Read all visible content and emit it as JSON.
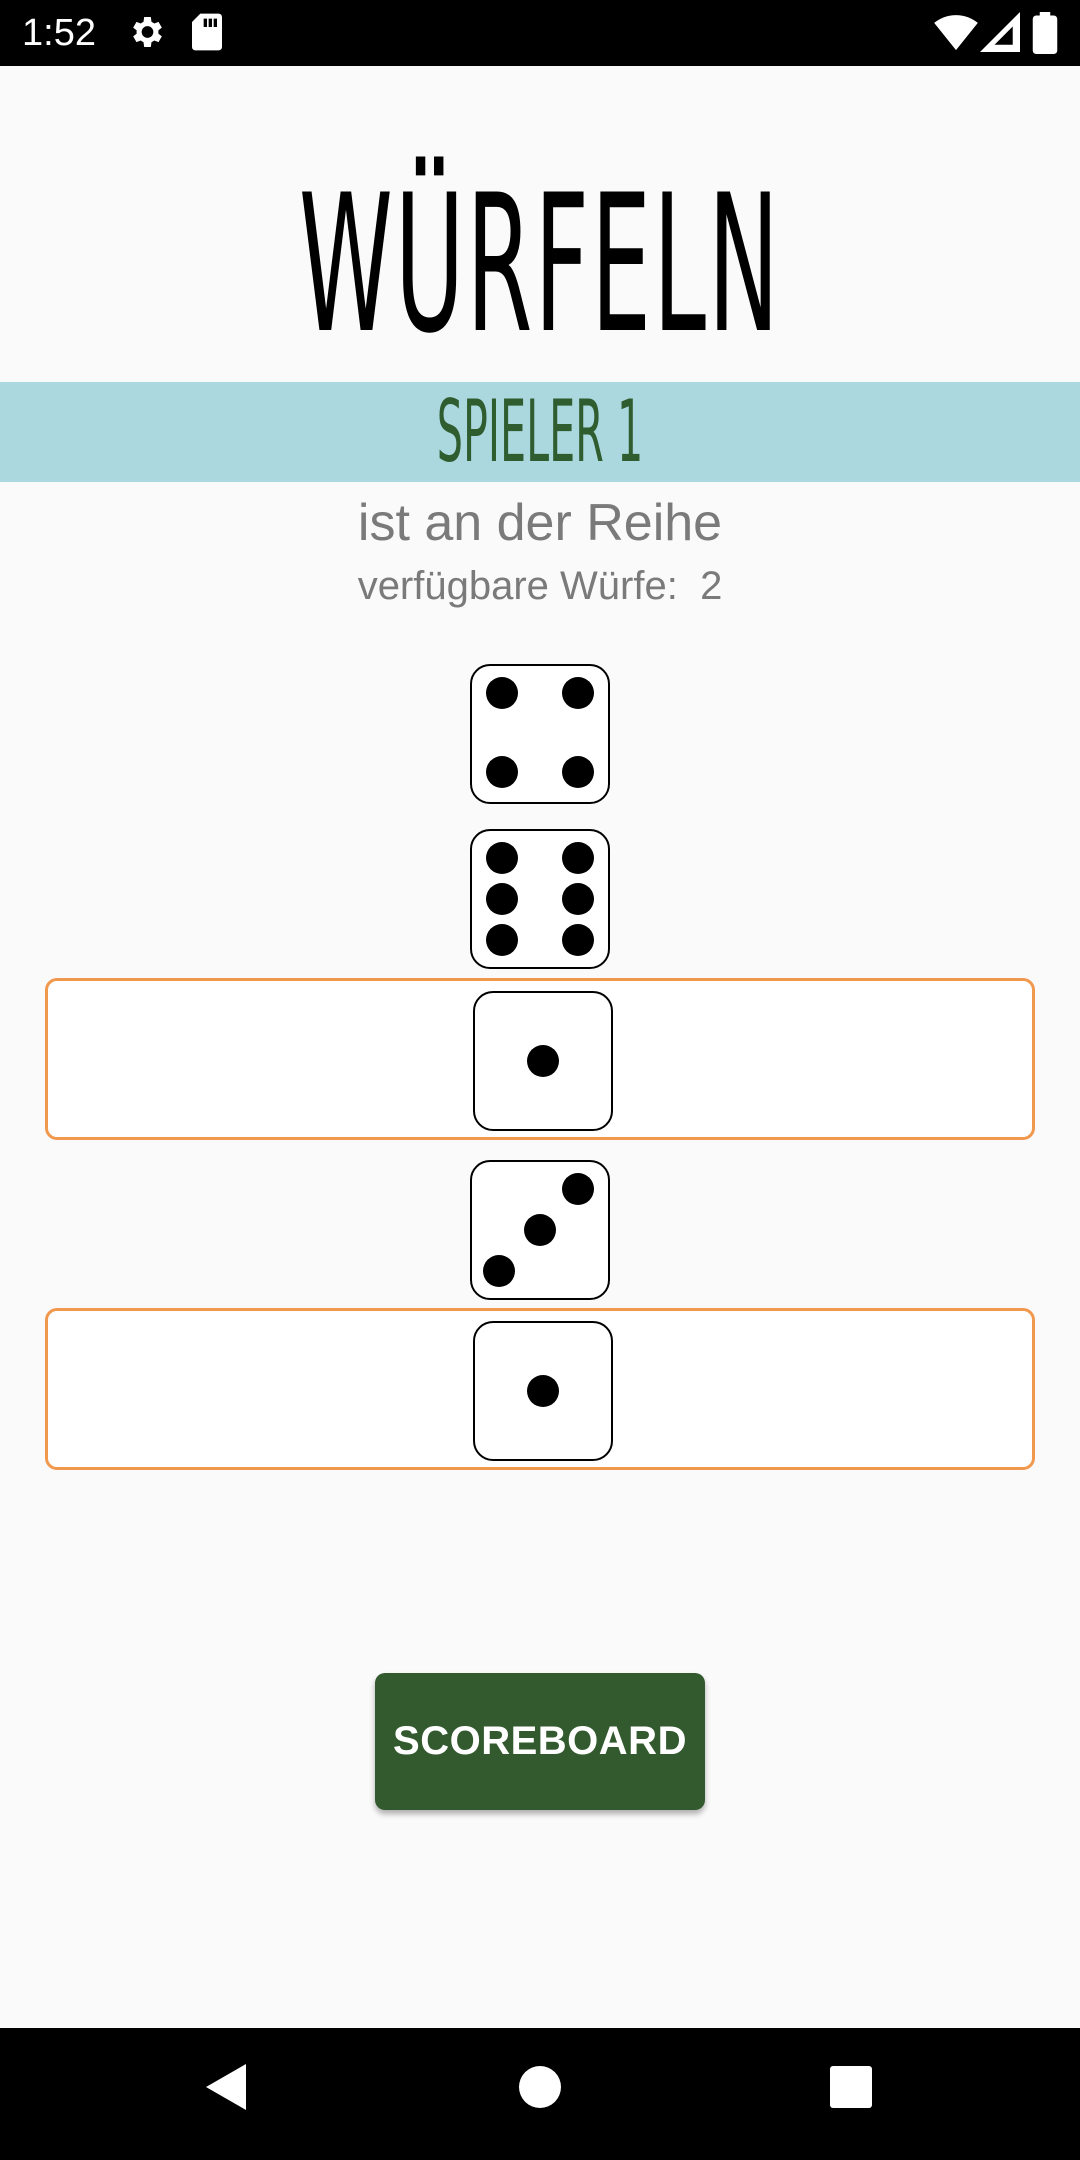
{
  "status_bar": {
    "time": "1:52",
    "icons": [
      "gear-icon",
      "sd-card-icon",
      "wifi-icon",
      "signal-icon",
      "battery-icon"
    ]
  },
  "app": {
    "title": "WÜRFELN",
    "player": "SPIELER 1",
    "turn_text": "ist an der Reihe",
    "throws_label": "verfügbare Würfe:",
    "throws_value": "2"
  },
  "dice": [
    {
      "value": 4,
      "held": false
    },
    {
      "value": 6,
      "held": false
    },
    {
      "value": 1,
      "held": true
    },
    {
      "value": 3,
      "held": false
    },
    {
      "value": 1,
      "held": true
    }
  ],
  "scoreboard_button": {
    "label": "SCOREBOARD"
  },
  "nav_bar": {
    "icons": [
      "back-icon",
      "home-icon",
      "recents-icon"
    ]
  },
  "colors": {
    "player_band": "#abd8df",
    "player_text": "#2f5d2f",
    "held_border": "#f0994e",
    "button": "#335a2e"
  }
}
